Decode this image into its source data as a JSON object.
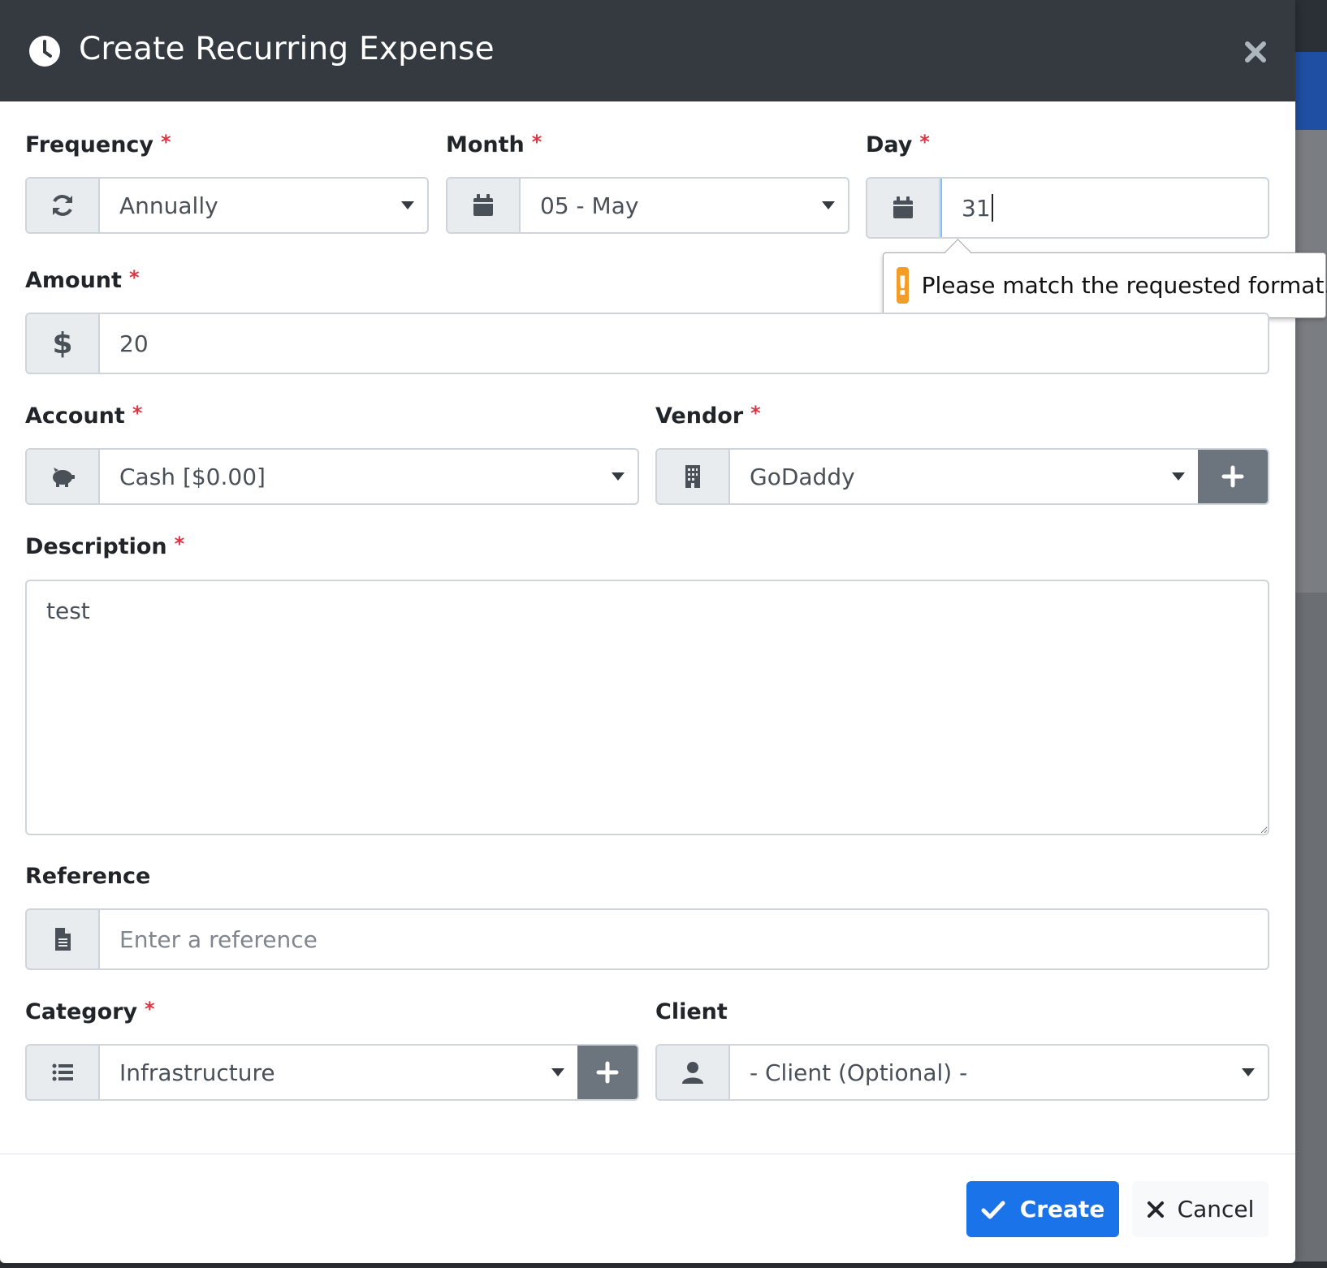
{
  "modal": {
    "title": "Create Recurring Expense",
    "header_icon": "clock-icon",
    "close_icon": "close-icon"
  },
  "required_marker": "*",
  "form": {
    "frequency": {
      "label": "Frequency",
      "value": "Annually",
      "icon": "sync-icon"
    },
    "month": {
      "label": "Month",
      "value": "05 - May",
      "icon": "calendar-icon"
    },
    "day": {
      "label": "Day",
      "value": "31",
      "icon": "calendar-icon"
    },
    "validation": {
      "message": "Please match the requested format.",
      "icon": "exclamation-icon",
      "icon_text": "!"
    },
    "amount": {
      "label": "Amount",
      "value": "20",
      "icon": "dollar-icon",
      "icon_text": "$"
    },
    "account": {
      "label": "Account",
      "value": "Cash [$0.00]",
      "icon": "piggy-bank-icon"
    },
    "vendor": {
      "label": "Vendor",
      "value": "GoDaddy",
      "icon": "building-icon"
    },
    "description": {
      "label": "Description",
      "value": "test"
    },
    "reference": {
      "label": "Reference",
      "placeholder": "Enter a reference",
      "icon": "file-icon"
    },
    "category": {
      "label": "Category",
      "value": "Infrastructure",
      "icon": "list-icon"
    },
    "client": {
      "label": "Client",
      "value": "- Client (Optional) -",
      "icon": "user-icon"
    }
  },
  "footer": {
    "create_label": "Create",
    "cancel_label": "Cancel"
  },
  "colors": {
    "header_bg": "#343a40",
    "primary": "#1a73e8",
    "secondary": "#6c757d",
    "required": "#dc3545",
    "warning": "#f39c27"
  }
}
